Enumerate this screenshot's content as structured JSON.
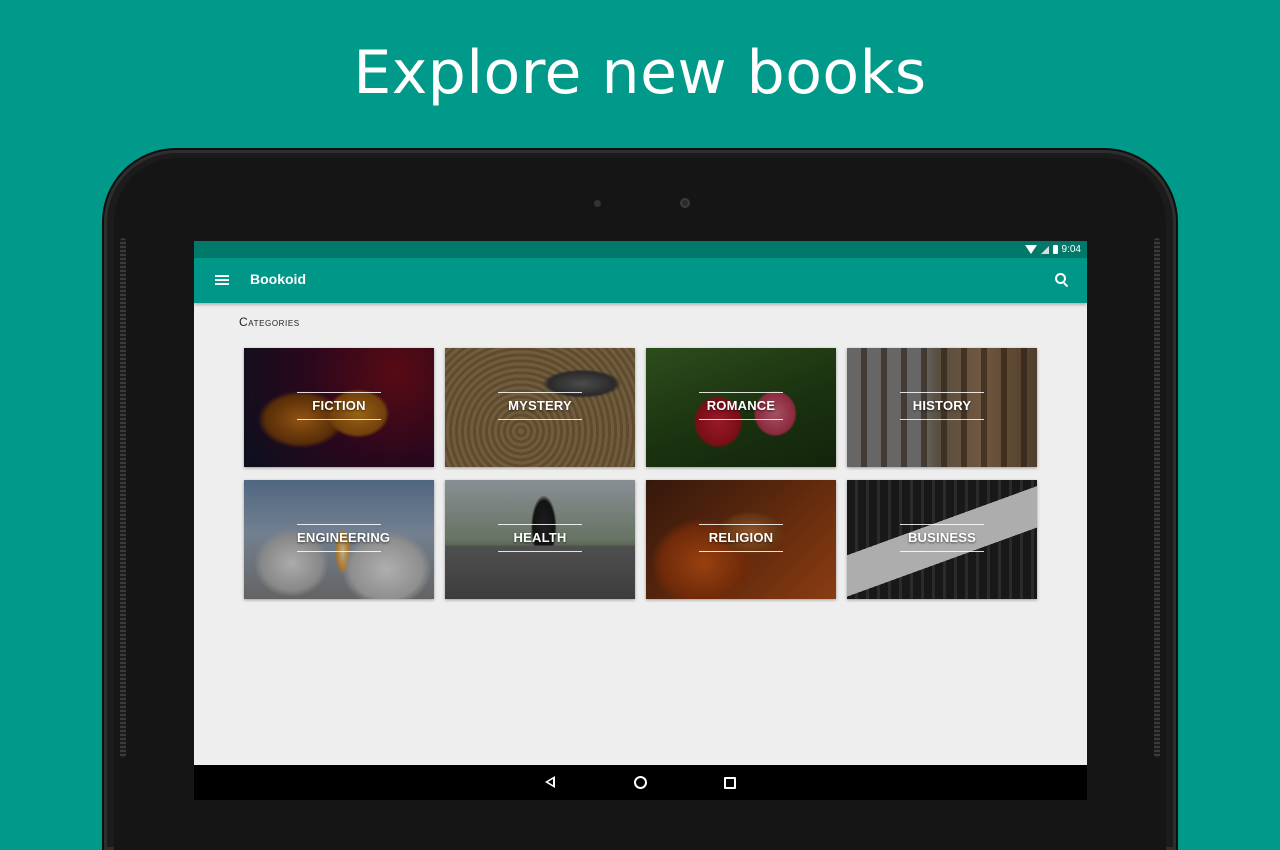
{
  "headline": "Explore new books",
  "status_bar": {
    "time": "9:04"
  },
  "app_bar": {
    "title": "Bookoid",
    "menu_icon": "menu-icon",
    "search_icon": "search-icon"
  },
  "section_title": "Categories",
  "categories": [
    {
      "label": "FICTION"
    },
    {
      "label": "MYSTERY"
    },
    {
      "label": "ROMANCE"
    },
    {
      "label": "HISTORY"
    },
    {
      "label": "ENGINEERING"
    },
    {
      "label": "HEALTH"
    },
    {
      "label": "RELIGION"
    },
    {
      "label": "BUSINESS"
    }
  ],
  "nav_bar": {
    "back_icon": "back-icon",
    "home_icon": "home-icon",
    "recents_icon": "recents-icon"
  },
  "colors": {
    "background": "#00998a",
    "app_bar": "#009688",
    "status_bar": "#00796b",
    "screen_bg": "#eeeeee"
  }
}
